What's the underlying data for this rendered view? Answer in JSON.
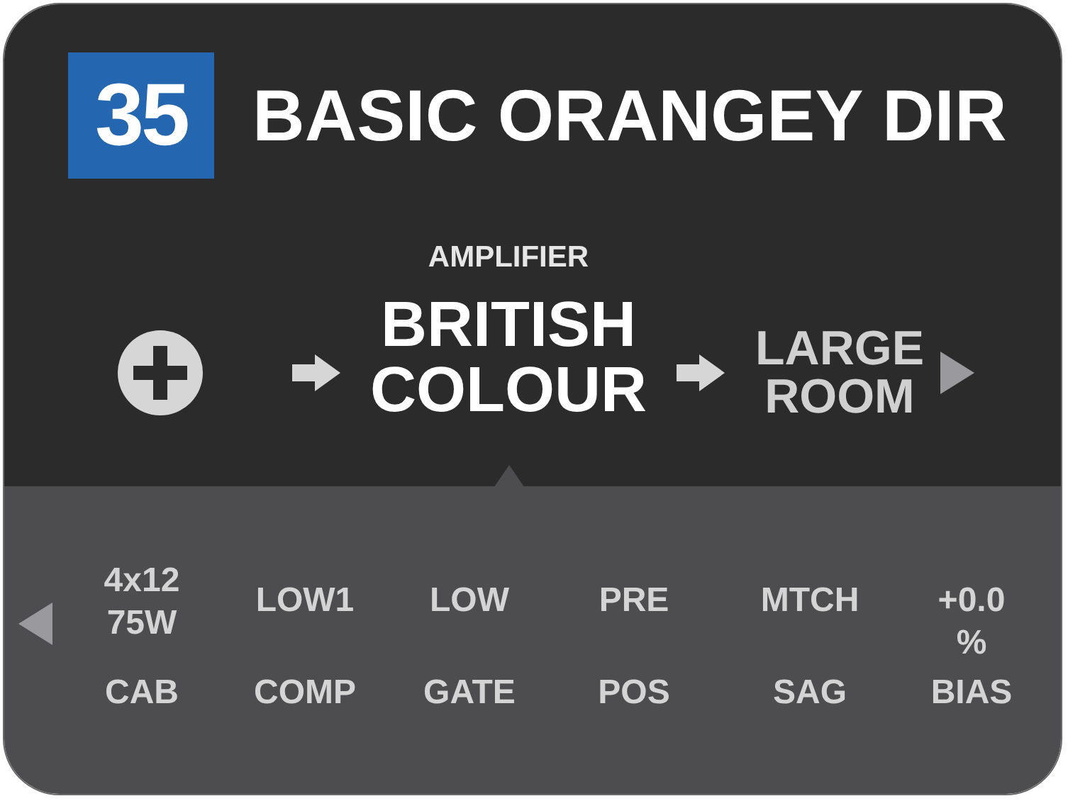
{
  "preset": {
    "number": "35",
    "name": "BASIC ORANGEY DIR"
  },
  "chain": [
    {
      "kind": "add"
    },
    {
      "kind": "block",
      "category": "AMPLIFIER",
      "name": [
        "BRITISH",
        "COLOUR"
      ],
      "selected": true
    },
    {
      "kind": "block",
      "name": [
        "LARGE",
        "ROOM"
      ],
      "selected": false
    }
  ],
  "params": [
    {
      "value": [
        "4x12",
        "75W"
      ],
      "label": "CAB"
    },
    {
      "value": [
        "LOW1"
      ],
      "label": "COMP"
    },
    {
      "value": [
        "LOW"
      ],
      "label": "GATE"
    },
    {
      "value": [
        "PRE"
      ],
      "label": "POS"
    },
    {
      "value": [
        "MTCH"
      ],
      "label": "SAG"
    },
    {
      "value": [
        "+0.0",
        "%"
      ],
      "label": "BIAS"
    }
  ]
}
